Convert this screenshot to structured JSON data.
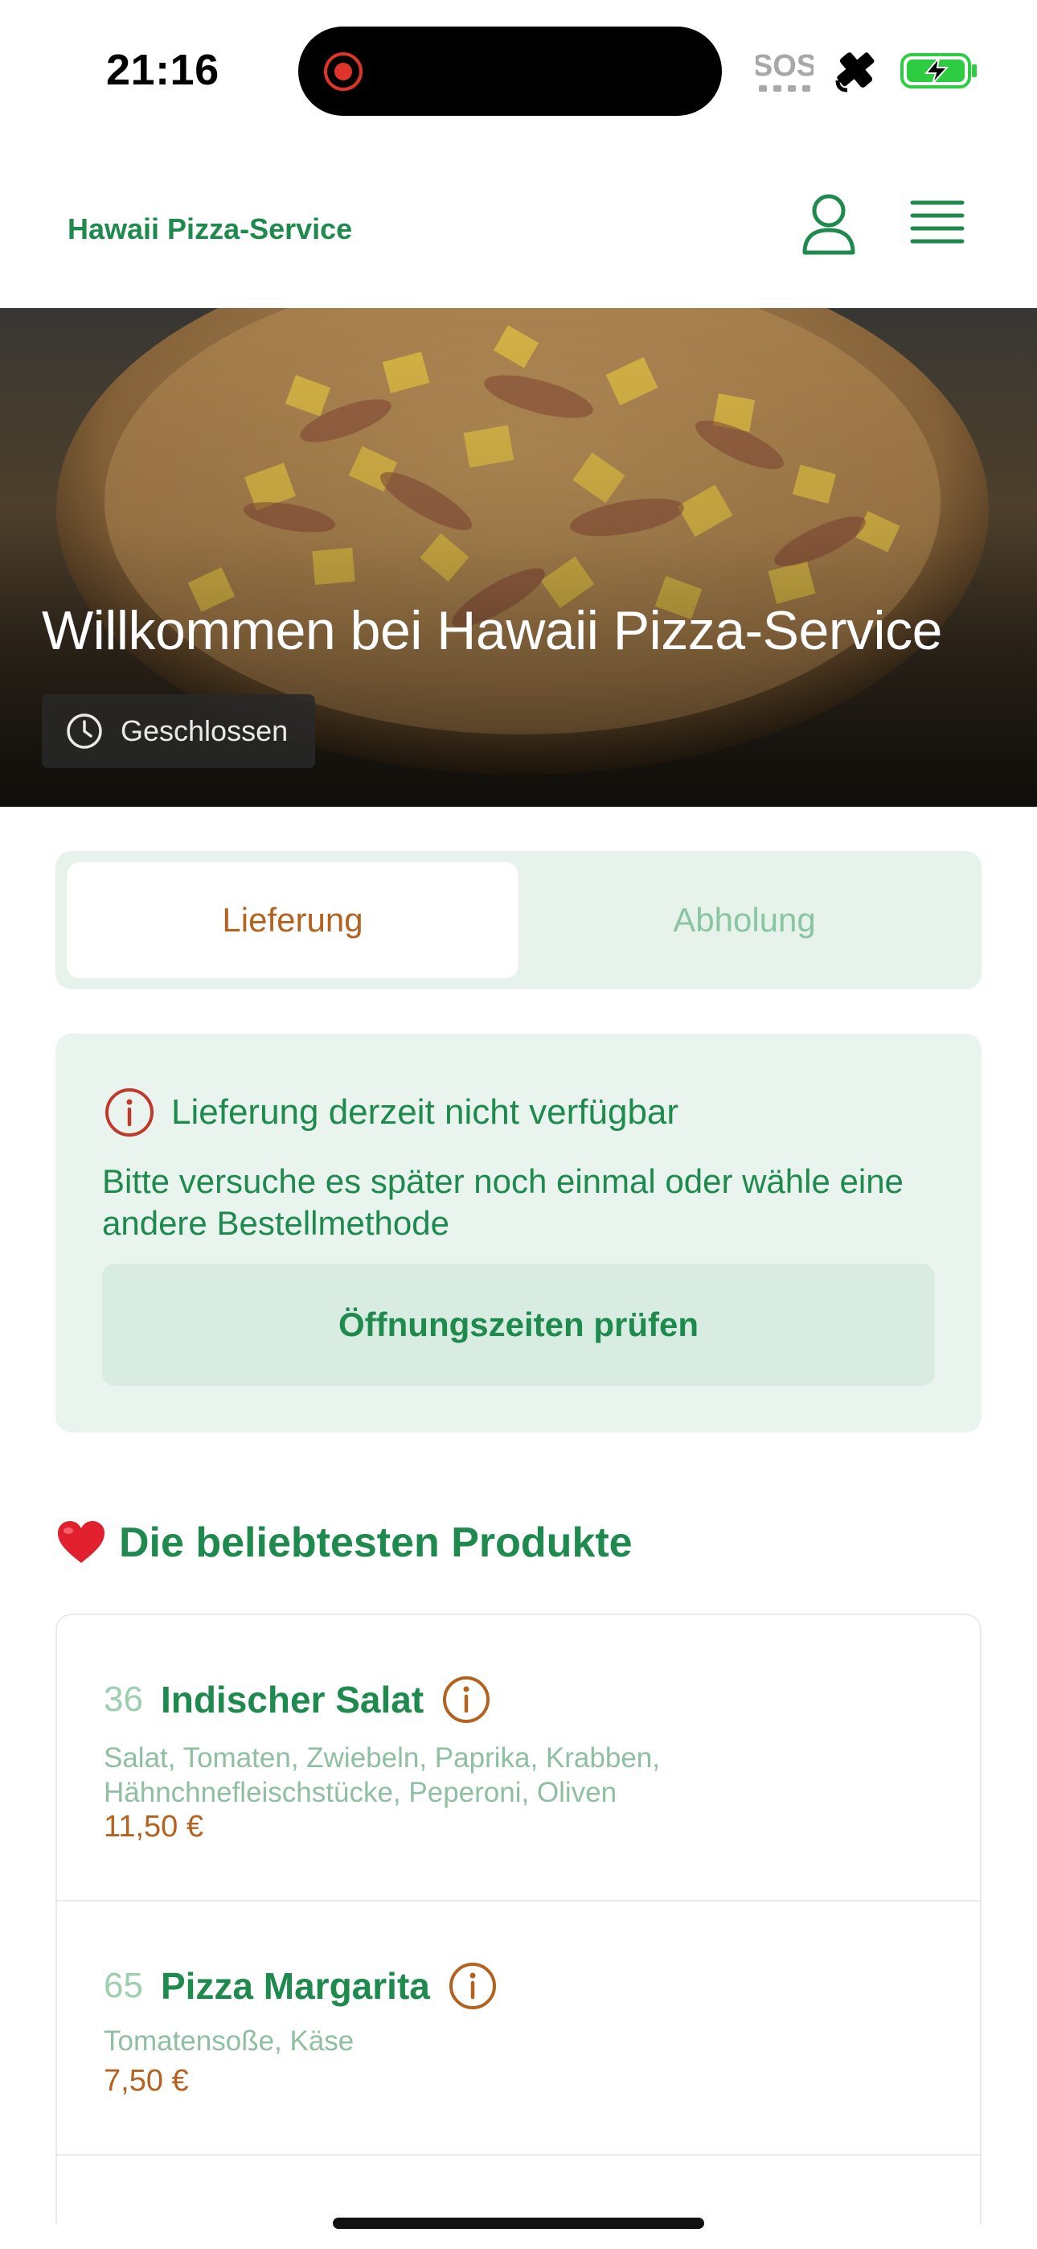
{
  "status_bar": {
    "time": "21:16",
    "sos": "SOS"
  },
  "header": {
    "brand": "Hawaii Pizza-Service"
  },
  "hero": {
    "title": "Willkommen bei Hawaii Pizza-Service",
    "status": "Geschlossen"
  },
  "mode_toggle": {
    "delivery": "Lieferung",
    "pickup": "Abholung",
    "selected": "Lieferung"
  },
  "notice": {
    "title": "Lieferung derzeit nicht verfügbar",
    "text": "Bitte versuche es später noch einmal oder wähle eine andere Bestellmethode",
    "button": "Öffnungszeiten prüfen"
  },
  "popular": {
    "title": "Die beliebtesten Produkte",
    "products": [
      {
        "number": "36",
        "name": "Indischer Salat",
        "description": "Salat, Tomaten, Zwiebeln, Paprika, Krabben, Hähnchnefleischstücke, Peperoni, Oliven",
        "price": "11,50 €"
      },
      {
        "number": "65",
        "name": "Pizza Margarita",
        "description": "Tomatensoße, Käse",
        "price": "7,50 €"
      }
    ]
  },
  "colors": {
    "brand_green": "#1e8a4e",
    "accent_brown": "#b3621f",
    "light_green": "#e6f2ea",
    "alert_red": "#c0392b"
  }
}
